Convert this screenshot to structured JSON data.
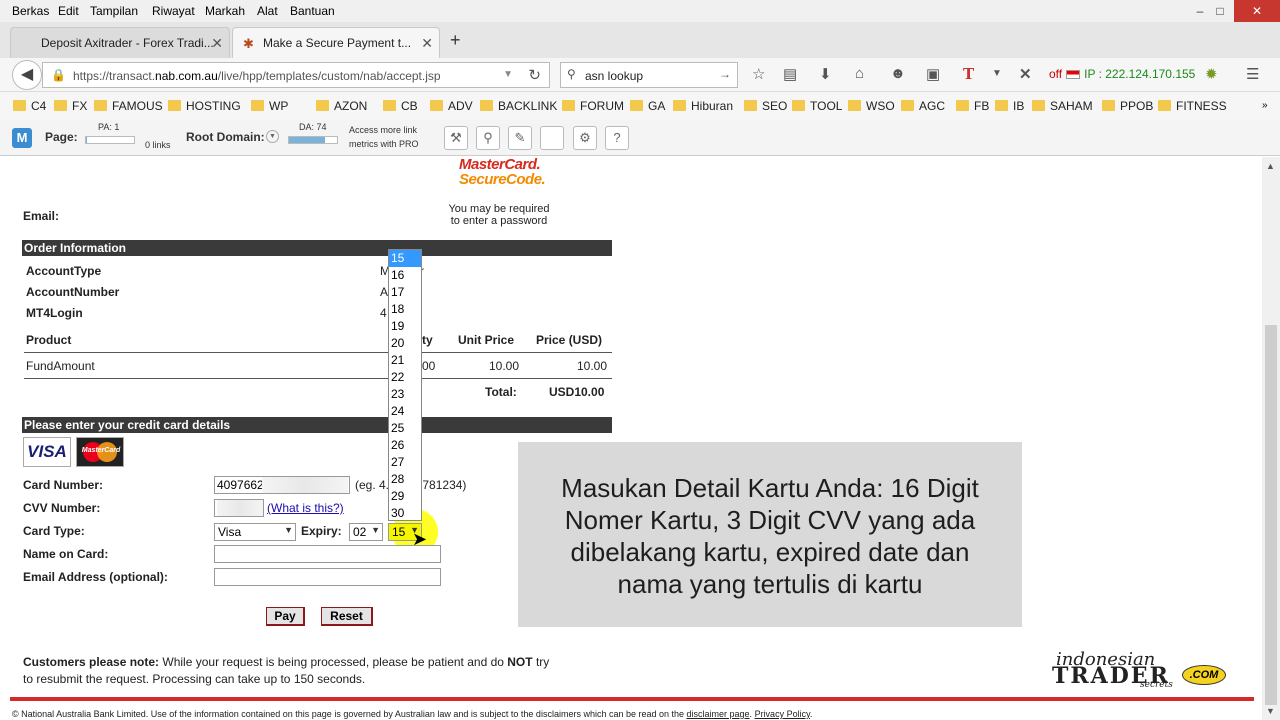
{
  "menu": [
    "Berkas",
    "Edit",
    "Tampilan",
    "Riwayat",
    "Markah",
    "Alat",
    "Bantuan"
  ],
  "window_controls": {
    "minimize": "–",
    "maximize": "□",
    "close": "✕"
  },
  "tabs": [
    {
      "label": "Deposit Axitrader - Forex Tradi...",
      "active": false
    },
    {
      "label": "Make a Secure Payment t...",
      "active": true
    }
  ],
  "new_tab": "+",
  "address": {
    "prefix": "https://transact.",
    "domain": "nab.com.au",
    "path": "/live/hpp/templates/custom/nab/accept.jsp"
  },
  "search": {
    "value": "asn lookup"
  },
  "ip": {
    "status": "off",
    "label": "IP : 222.124.170.155"
  },
  "bookmarks": [
    "C4",
    "FX",
    "FAMOUS",
    "HOSTING",
    "WP",
    "AZON",
    "CB",
    "ADV",
    "BACKLINK",
    "FORUM",
    "GA",
    "Hiburan",
    "SEO",
    "TOOL",
    "WSO",
    "AGC",
    "FB",
    "IB",
    "SAHAM",
    "PPOB",
    "FITNESS"
  ],
  "mozbar": {
    "page_label": "Page:",
    "pa": "PA: 1",
    "links": "0 links",
    "root_label": "Root Domain:",
    "da": "DA: 74",
    "da_fill": 0.74,
    "pro_line1": "Access more link",
    "pro_line2": "metrics with PRO"
  },
  "securecode": {
    "brand": "MasterCard.",
    "product": "SecureCode.",
    "note_line1": "You may be required",
    "note_line2": "to enter a password"
  },
  "email_label": "Email:",
  "order": {
    "header": "Order Information",
    "account_type": {
      "label": "AccountType",
      "value": "M...ader"
    },
    "account_number": {
      "label": "AccountNumber",
      "value": "A...73"
    },
    "mt4login": {
      "label": "MT4Login",
      "value": "4"
    },
    "columns": {
      "product": "Product",
      "qty": "ty",
      "unit_price": "Unit Price",
      "price": "Price (USD)"
    },
    "row": {
      "product": "FundAmount",
      "qty": "00",
      "unit_price": "10.00",
      "price": "10.00"
    },
    "total_label": "Total:",
    "total_value": "USD10.00"
  },
  "card": {
    "header": "Please enter your credit card details",
    "visa": "VISA",
    "mastercard": "MasterCard",
    "number_label": "Card Number:",
    "number_value": "4097662",
    "number_example": "(eg. 4...3456781234)",
    "cvv_label": "CVV Number:",
    "cvv_help": "(What is this?)",
    "type_label": "Card Type:",
    "type_value": "Visa",
    "expiry_label": "Expiry:",
    "expiry_month": "02",
    "expiry_year": "15",
    "name_label": "Name on Card:",
    "email_label": "Email Address (optional):"
  },
  "year_options": [
    "15",
    "16",
    "17",
    "18",
    "19",
    "20",
    "21",
    "22",
    "23",
    "24",
    "25",
    "26",
    "27",
    "28",
    "29",
    "30"
  ],
  "buttons": {
    "pay": "Pay",
    "reset": "Reset"
  },
  "overlay": {
    "line1": "Masukan Detail Kartu Anda: 16 Digit",
    "line2": "Nomer Kartu, 3 Digit CVV yang ada",
    "line3": "dibelakang kartu, expired date dan",
    "line4": "nama yang tertulis di kartu"
  },
  "customer_note": {
    "bold_lead": "Customers please note:",
    "text_a": " While your request is being processed, please be patient and do ",
    "bold_not": "NOT",
    "text_b": " try",
    "line2": "to resubmit the request. Processing can take up to 150 seconds."
  },
  "brand": {
    "w1": "indonesian",
    "w2": "TRADER",
    "w3": "secrets",
    "w4": ".COM"
  },
  "copyright": {
    "text": "© National Australia Bank Limited. Use of the information contained on this page is governed by Australian law and is subject to the disclaimers which can be read on the ",
    "disclaimer": "disclaimer page",
    "sep": ". ",
    "privacy": "Privacy Policy",
    "end": "."
  },
  "colors": {
    "accent_red": "#d52a2a",
    "secure_red": "#d62b1f",
    "secure_orange": "#f28b00",
    "highlight": "#f5f500"
  }
}
